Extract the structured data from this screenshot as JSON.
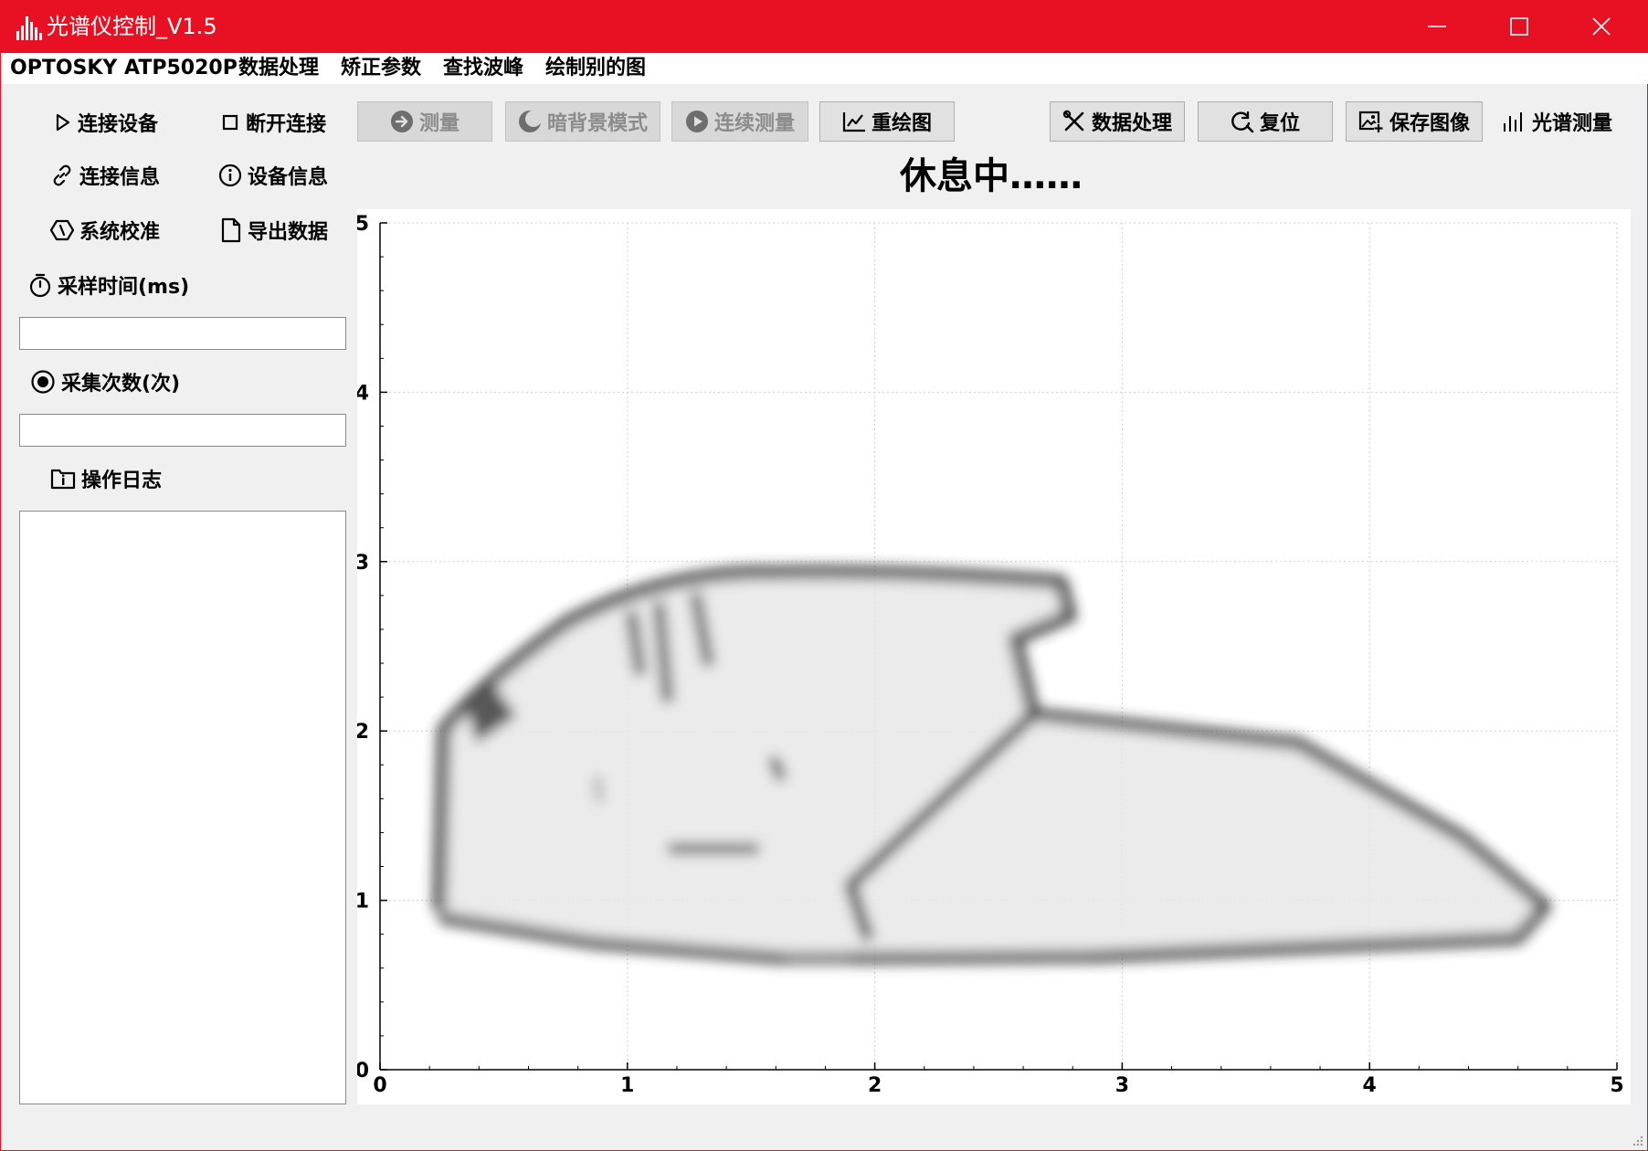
{
  "window": {
    "title": "光谱仪控制_V1.5",
    "accent_color": "#e81123",
    "controls": [
      "minimize-icon",
      "maximize-icon",
      "close-icon"
    ]
  },
  "menu": {
    "items": [
      "OPTOSKY ATP5020P",
      "数据处理",
      "矫正参数",
      "查找波峰",
      "绘制别的图"
    ]
  },
  "sidebar": {
    "connect": "连接设备",
    "disconnect": "断开连接",
    "connection_info": "连接信息",
    "device_info": "设备信息",
    "calibration": "系统校准",
    "export": "导出数据",
    "sample_time_label": "采样时间(ms)",
    "sample_time_value": "",
    "acquire_count_label": "采集次数(次)",
    "acquire_count_value": "",
    "log_label": "操作日志",
    "log_content": ""
  },
  "toolbar": {
    "measure": "测量",
    "dark_mode": "暗背景模式",
    "continuous": "连续测量",
    "redraw": "重绘图",
    "data_process": "数据处理",
    "reset": "复位",
    "save_image": "保存图像",
    "spectrum": "光谱测量"
  },
  "status_text": "休息中……",
  "chart_data": {
    "type": "scatter",
    "title": "",
    "xlabel": "",
    "ylabel": "",
    "xlim": [
      0,
      5
    ],
    "ylim": [
      0,
      5
    ],
    "x_ticks": [
      "0",
      "1",
      "2",
      "3",
      "4",
      "5"
    ],
    "y_ticks": [
      "0",
      "1",
      "2",
      "3",
      "4",
      "5"
    ],
    "grid": true,
    "series": []
  }
}
